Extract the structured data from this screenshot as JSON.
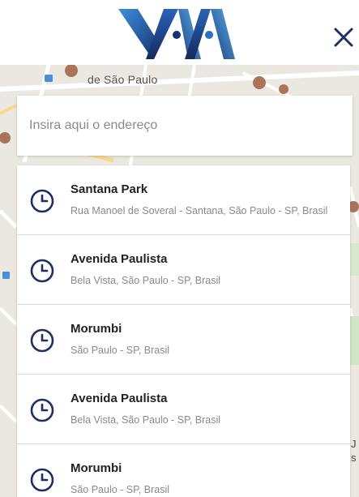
{
  "header": {
    "logo_icon": "yaa-logo",
    "close_icon": "close-icon"
  },
  "map": {
    "label": "de São Paulo",
    "edge_right": [
      "J",
      "s"
    ]
  },
  "search": {
    "placeholder": "Insira aqui o endereço",
    "value": ""
  },
  "results": [
    {
      "icon": "clock-icon",
      "title": "Santana Park",
      "subtitle": "Rua Manoel de Soveral - Santana, São Paulo - SP, Brasil"
    },
    {
      "icon": "clock-icon",
      "title": "Avenida Paulista",
      "subtitle": "Bela Vista, São Paulo - SP, Brasil"
    },
    {
      "icon": "clock-icon",
      "title": "Morumbi",
      "subtitle": "São Paulo - SP, Brasil"
    },
    {
      "icon": "clock-icon",
      "title": "Avenida Paulista",
      "subtitle": "Bela Vista, São Paulo - SP, Brasil"
    },
    {
      "icon": "clock-icon",
      "title": "Morumbi",
      "subtitle": "São Paulo - SP, Brasil"
    }
  ],
  "colors": {
    "brand_dark": "#1a3170",
    "brand_blue": "#2f6fc3",
    "brand_light": "#5aa7e6",
    "clock_icon": "#1e2f66",
    "map_bg": "#ebe8e1"
  }
}
